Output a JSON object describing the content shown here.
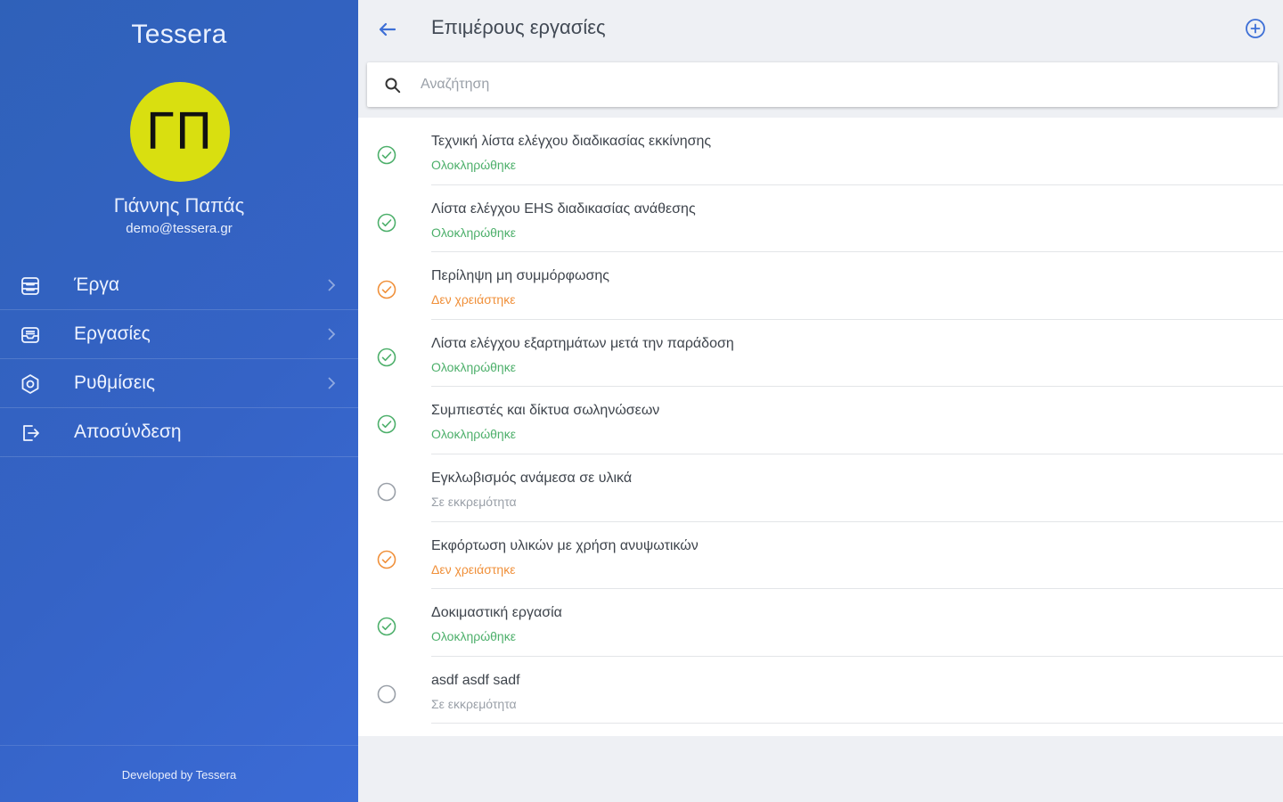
{
  "app": {
    "title": "Tessera"
  },
  "user": {
    "initials": "ΓΠ",
    "name": "Γιάννης Παπάς",
    "email": "demo@tessera.gr",
    "avatar_color": "#d9df10"
  },
  "menu": [
    {
      "label": "Έργα",
      "icon": "inbox-stack-icon",
      "has_chevron": true
    },
    {
      "label": "Εργασίες",
      "icon": "inbox-icon",
      "has_chevron": true
    },
    {
      "label": "Ρυθμίσεις",
      "icon": "gear-icon",
      "has_chevron": true
    },
    {
      "label": "Αποσύνδεση",
      "icon": "logout-icon",
      "has_chevron": false
    }
  ],
  "footer": {
    "text": "Developed by Tessera"
  },
  "header": {
    "title": "Επιμέρους εργασίες",
    "back_icon": "arrow-left-icon",
    "add_icon": "plus-circle-icon"
  },
  "search": {
    "placeholder": "Αναζήτηση",
    "value": ""
  },
  "colors": {
    "completed": "#4caf6a",
    "not_needed": "#f0903a",
    "pending": "#9aa0a8",
    "accent": "#3d6fd6"
  },
  "tasks": [
    {
      "title": "Τεχνική λίστα ελέγχου διαδικασίας εκκίνησης",
      "status": "Ολοκληρώθηκε",
      "state": "completed"
    },
    {
      "title": "Λίστα ελέγχου EHS διαδικασίας ανάθεσης",
      "status": "Ολοκληρώθηκε",
      "state": "completed"
    },
    {
      "title": "Περίληψη μη συμμόρφωσης",
      "status": "Δεν χρειάστηκε",
      "state": "not_needed"
    },
    {
      "title": "Λίστα ελέγχου εξαρτημάτων μετά την παράδοση",
      "status": "Ολοκληρώθηκε",
      "state": "completed"
    },
    {
      "title": "Συμπιεστές και δίκτυα σωληνώσεων",
      "status": "Ολοκληρώθηκε",
      "state": "completed"
    },
    {
      "title": "Εγκλωβισμός ανάμεσα σε υλικά",
      "status": "Σε εκκρεμότητα",
      "state": "pending"
    },
    {
      "title": "Εκφόρτωση υλικών με χρήση ανυψωτικών",
      "status": "Δεν χρειάστηκε",
      "state": "not_needed"
    },
    {
      "title": "Δοκιμαστική εργασία",
      "status": "Ολοκληρώθηκε",
      "state": "completed"
    },
    {
      "title": "asdf asdf sadf",
      "status": "Σε εκκρεμότητα",
      "state": "pending"
    }
  ]
}
